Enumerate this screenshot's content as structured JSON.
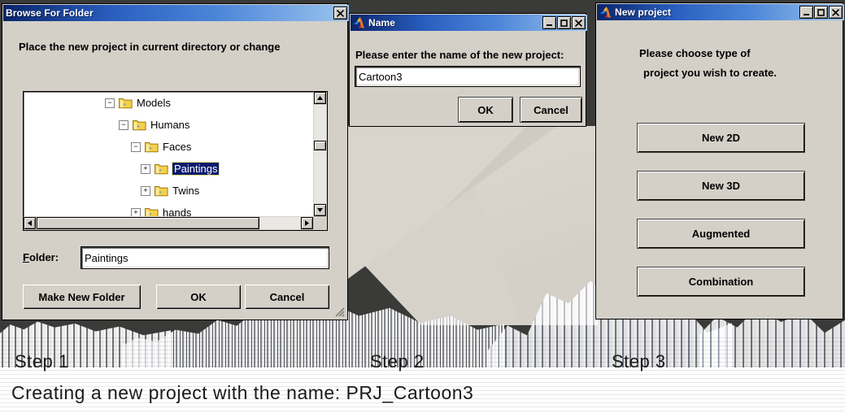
{
  "browse_dialog": {
    "title": "Browse For Folder",
    "close_label": "✕",
    "instruction": "Place the new project in current directory or change",
    "tree": [
      {
        "indent": 0,
        "toggle": "−",
        "label": "Models",
        "selected": false
      },
      {
        "indent": 1,
        "toggle": "−",
        "label": "Humans",
        "selected": false
      },
      {
        "indent": 2,
        "toggle": "−",
        "label": "Faces",
        "selected": false
      },
      {
        "indent": 3,
        "toggle": "+",
        "label": "Paintings",
        "selected": true
      },
      {
        "indent": 3,
        "toggle": "+",
        "label": "Twins",
        "selected": false
      },
      {
        "indent": 3,
        "toggle": "+",
        "label": "hands",
        "selected": false
      }
    ],
    "folder_label": "Folder:",
    "folder_value": "Paintings",
    "buttons": {
      "make_new_folder": "Make New Folder",
      "ok": "OK",
      "cancel": "Cancel"
    }
  },
  "name_dialog": {
    "title": "Name",
    "minimize_label": "_",
    "maximize_label": "◻",
    "close_label": "✕",
    "prompt": "Please enter the name of the new project:",
    "input_value": "Cartoon3",
    "buttons": {
      "ok": "OK",
      "cancel": "Cancel"
    }
  },
  "new_project_dialog": {
    "title": "New project",
    "minimize_label": "_",
    "maximize_label": "◻",
    "close_label": "✕",
    "prompt_line1": "Please choose type of",
    "prompt_line2": "project you wish to create.",
    "buttons": [
      {
        "label": "New 2D"
      },
      {
        "label": "New 3D"
      },
      {
        "label": "Augmented"
      },
      {
        "label": "Combination"
      }
    ]
  },
  "caption": {
    "step1": "Step 1",
    "step2": "Step 2",
    "step3": "Step 3",
    "summary": "Creating a new project with the name: PRJ_Cartoon3"
  },
  "colors": {
    "titlebar_dark": "#0a246a",
    "titlebar_light": "#9cc4ef",
    "dialog_face": "#d4d0c8",
    "selection": "#0a1a6e",
    "backdrop": "#3a3a38",
    "folder_yellow": "#fcd667"
  }
}
